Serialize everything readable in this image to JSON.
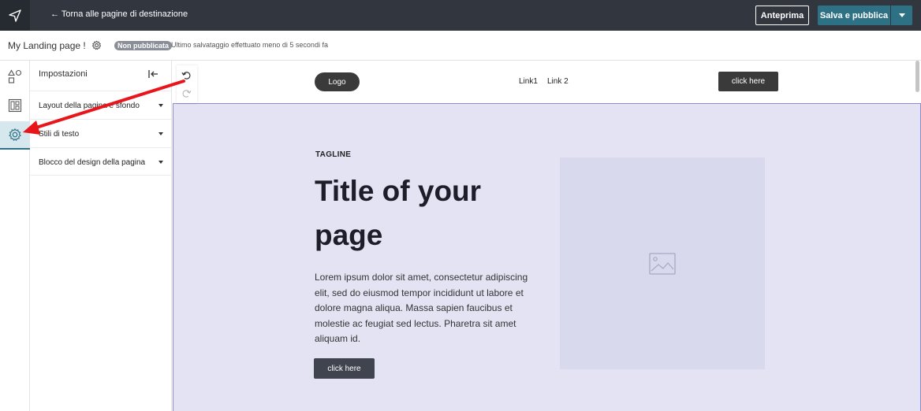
{
  "topbar": {
    "back_label": "← Torna alle pagine di destinazione",
    "preview_label": "Anteprima",
    "save_label": "Salva e pubblica"
  },
  "subbar": {
    "page_name": "My Landing page !",
    "status_badge": "Non pubblicata",
    "saved_text": "Ultimo salvataggio effettuato meno di 5 secondi fa"
  },
  "panel": {
    "title": "Impostazioni",
    "items": [
      {
        "label": "Layout della pagina e sfondo"
      },
      {
        "label": "Stili di testo"
      },
      {
        "label": "Blocco del design della pagina"
      }
    ]
  },
  "canvas": {
    "nav": {
      "logo": "Logo",
      "links": [
        "Link1",
        "Link 2"
      ],
      "cta": "click here"
    },
    "hero": {
      "tagline": "TAGLINE",
      "title": "Title of your page",
      "body": "Lorem ipsum dolor sit amet, consectetur adipiscing elit, sed do eiusmod tempor incididunt ut labore et dolore magna aliqua. Massa sapien faucibus et molestie ac feugiat sed lectus. Pharetra sit amet aliquam id.",
      "cta": "click here"
    }
  },
  "colors": {
    "topbar": "#32363f",
    "accent": "#2e7185",
    "hero_bg": "#e3e3f3",
    "hero_border": "#8b8bd1",
    "annotation": "#e8151b"
  },
  "icons": {
    "app_logo": "paper-plane-icon",
    "page_settings": "gear-icon",
    "rail": [
      "shapes-icon",
      "layout-icon",
      "gear-icon"
    ],
    "collapse": "collapse-left-icon",
    "undo": "undo-icon",
    "redo": "redo-icon",
    "placeholder": "image-placeholder-icon"
  }
}
